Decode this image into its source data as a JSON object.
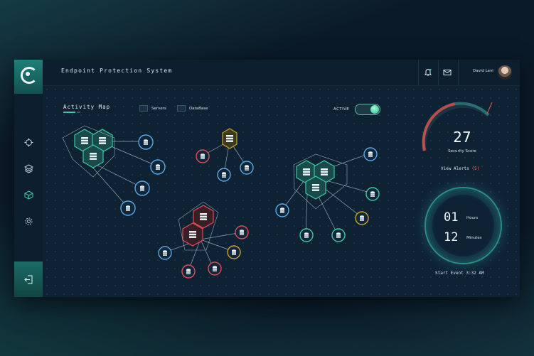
{
  "header": {
    "title": "Endpoint Protection System",
    "user_name": "David Levi"
  },
  "map": {
    "title": "Activity Map",
    "legend": [
      {
        "label": "Servers"
      },
      {
        "label": "DataBase"
      }
    ]
  },
  "toggle": {
    "label": "ACTIVE",
    "state": "on"
  },
  "score": {
    "value": "27",
    "label": "Security Score"
  },
  "alerts": {
    "label": "View Alerts",
    "count": "(5)"
  },
  "timer": {
    "hours": "01",
    "hours_label": "Hours",
    "minutes": "12",
    "minutes_label": "Minutes",
    "start": "Start Event 3:32 AM"
  },
  "colors": {
    "accent": "#39c9a4",
    "blue": "#5aa9e6",
    "red": "#e14b55",
    "gold": "#c9a227"
  },
  "icons": [
    "logo-icon",
    "bell-icon",
    "mail-icon",
    "target-icon",
    "layers-icon",
    "cube-icon",
    "gear-icon",
    "logout-icon"
  ]
}
